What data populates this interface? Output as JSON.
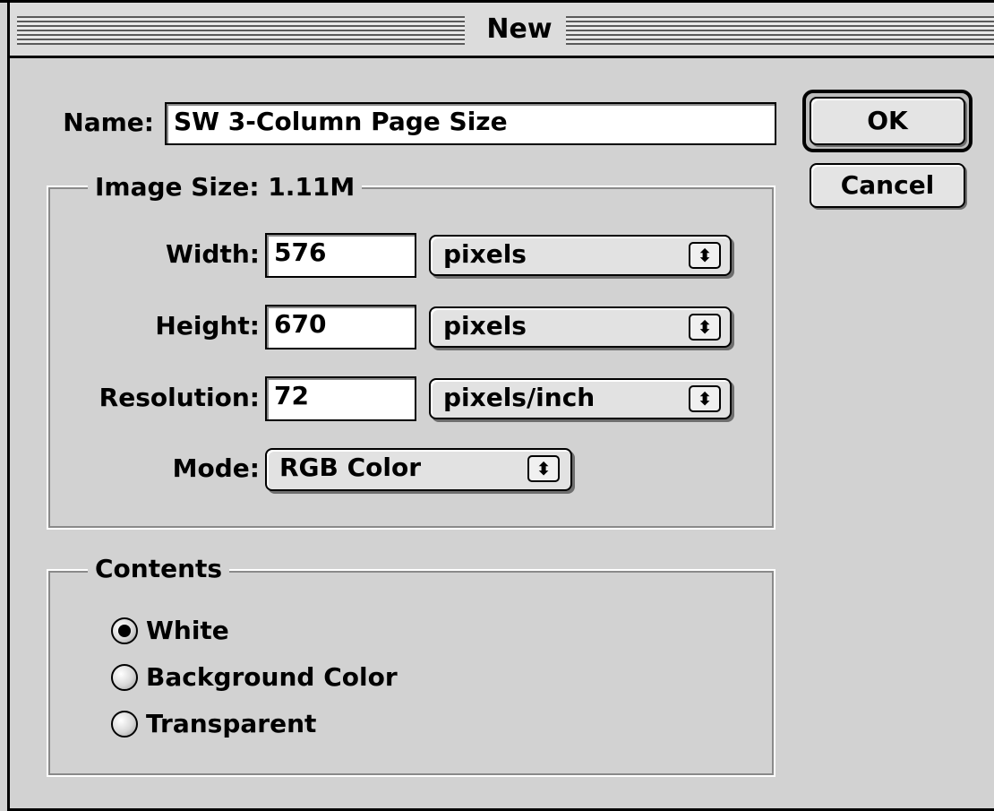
{
  "dialog": {
    "title": "New",
    "name_label": "Name:",
    "name_value": "SW 3-Column Page Size",
    "ok_label": "OK",
    "cancel_label": "Cancel"
  },
  "image_size": {
    "title": "Image Size:",
    "size_value": "1.11M",
    "width": {
      "label": "Width:",
      "value": "576",
      "unit": "pixels"
    },
    "height": {
      "label": "Height:",
      "value": "670",
      "unit": "pixels"
    },
    "resolution": {
      "label": "Resolution:",
      "value": "72",
      "unit": "pixels/inch"
    },
    "mode": {
      "label": "Mode:",
      "value": "RGB Color"
    }
  },
  "contents": {
    "title": "Contents",
    "options": [
      {
        "label": "White",
        "selected": true
      },
      {
        "label": "Background Color",
        "selected": false
      },
      {
        "label": "Transparent",
        "selected": false
      }
    ]
  },
  "icons": {
    "popup_arrows": "up-down-arrows-icon",
    "radio": "radio-button-icon"
  }
}
